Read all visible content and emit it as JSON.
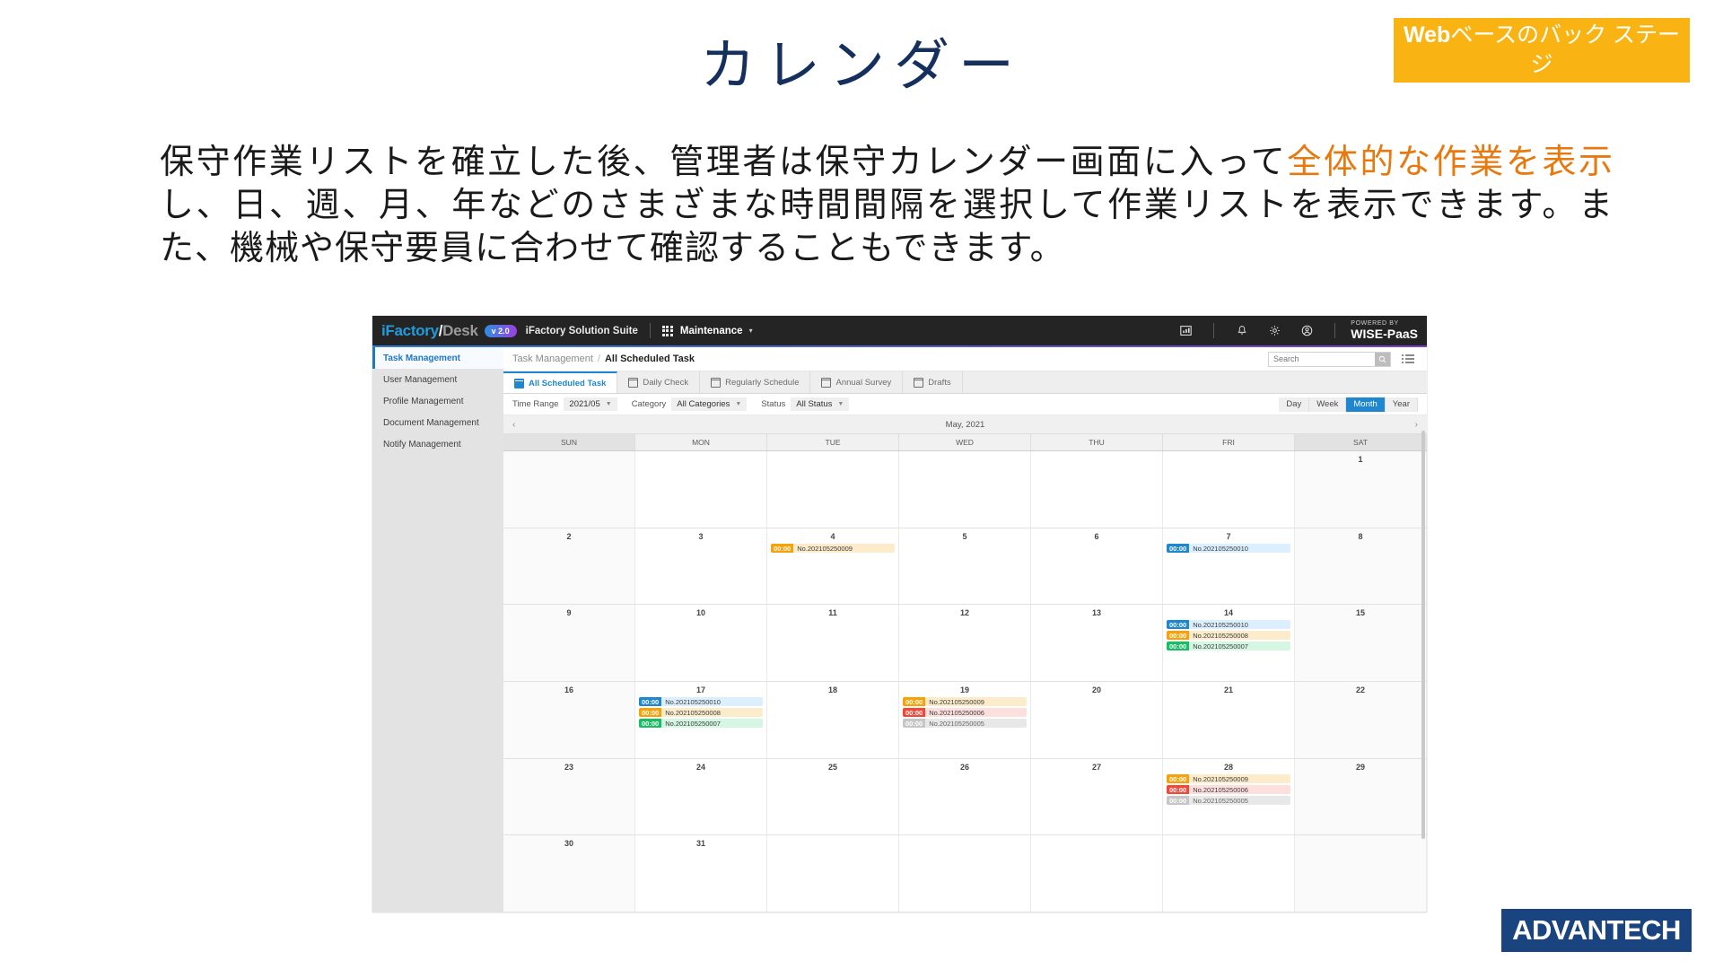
{
  "slide": {
    "title": "カレンダー",
    "badge_bold": "Web",
    "badge_rest": "ベースのバック ステージ",
    "paragraph_1": "保守作業リストを確立した後、管理者は保守カレンダー画面に入って",
    "paragraph_highlight": "全体的な作業を表示",
    "paragraph_2": "し、日、週、月、年などのさまざまな時間間隔を選択して作業リストを表示できます。また、機械や保守要員に合わせて確認することもできます。",
    "footer_logo": "ADVANTECH",
    "accent_color": "#f9b413",
    "title_color": "#16305e",
    "highlight_color": "#e8790f",
    "logo_color": "#1a4480"
  },
  "app": {
    "brand": {
      "i": "iFactory",
      "slash": "/",
      "desk": "Desk",
      "version": "v 2.0",
      "suite": "iFactory Solution Suite"
    },
    "module": "Maintenance",
    "powered_by": "POWERED BY",
    "platform": "WISE-PaaS",
    "header_icons": [
      "report-icon",
      "bell-icon",
      "gear-icon",
      "account-icon"
    ],
    "sidebar": {
      "items": [
        {
          "label": "Task Management",
          "active": true
        },
        {
          "label": "User Management",
          "active": false
        },
        {
          "label": "Profile Management",
          "active": false
        },
        {
          "label": "Document Management",
          "active": false
        },
        {
          "label": "Notify Management",
          "active": false
        }
      ]
    },
    "breadcrumb": {
      "parent": "Task Management",
      "separator": "/",
      "current": "All Scheduled Task"
    },
    "search": {
      "placeholder": "Search",
      "value": ""
    },
    "tabs": [
      {
        "label": "All Scheduled Task",
        "active": true
      },
      {
        "label": "Daily Check",
        "active": false
      },
      {
        "label": "Regularly Schedule",
        "active": false
      },
      {
        "label": "Annual Survey",
        "active": false
      },
      {
        "label": "Drafts",
        "active": false
      }
    ],
    "filters": [
      {
        "label": "Time Range",
        "value": "2021/05"
      },
      {
        "label": "Category",
        "value": "All Categories"
      },
      {
        "label": "Status",
        "value": "All Status"
      }
    ],
    "view_modes": [
      {
        "label": "Day",
        "active": false
      },
      {
        "label": "Week",
        "active": false
      },
      {
        "label": "Month",
        "active": true
      },
      {
        "label": "Year",
        "active": false
      }
    ],
    "calendar": {
      "month_label": "May, 2021",
      "prev_arrow": "‹",
      "next_arrow": "›",
      "day_headers": [
        "SUN",
        "MON",
        "TUE",
        "WED",
        "THU",
        "FRI",
        "SAT"
      ],
      "weeks": [
        [
          {
            "day": ""
          },
          {
            "day": ""
          },
          {
            "day": ""
          },
          {
            "day": ""
          },
          {
            "day": ""
          },
          {
            "day": ""
          },
          {
            "day": "1",
            "events": []
          }
        ],
        [
          {
            "day": "2",
            "events": []
          },
          {
            "day": "3",
            "events": []
          },
          {
            "day": "4",
            "events": [
              {
                "time": "00:00",
                "no": "No.202105250009",
                "color": "orange"
              }
            ]
          },
          {
            "day": "5",
            "events": []
          },
          {
            "day": "6",
            "events": []
          },
          {
            "day": "7",
            "events": [
              {
                "time": "00:00",
                "no": "No.202105250010",
                "color": "blue"
              }
            ]
          },
          {
            "day": "8",
            "events": []
          }
        ],
        [
          {
            "day": "9",
            "events": []
          },
          {
            "day": "10",
            "events": []
          },
          {
            "day": "11",
            "events": []
          },
          {
            "day": "12",
            "events": []
          },
          {
            "day": "13",
            "events": []
          },
          {
            "day": "14",
            "events": [
              {
                "time": "00:00",
                "no": "No.202105250010",
                "color": "blue"
              },
              {
                "time": "00:00",
                "no": "No.202105250008",
                "color": "orange"
              },
              {
                "time": "00:00",
                "no": "No.202105250007",
                "color": "green"
              }
            ]
          },
          {
            "day": "15",
            "events": []
          }
        ],
        [
          {
            "day": "16",
            "events": []
          },
          {
            "day": "17",
            "events": [
              {
                "time": "00:00",
                "no": "No.202105250010",
                "color": "blue"
              },
              {
                "time": "00:00",
                "no": "No.202105250008",
                "color": "orange"
              },
              {
                "time": "00:00",
                "no": "No.202105250007",
                "color": "green"
              }
            ]
          },
          {
            "day": "18",
            "events": []
          },
          {
            "day": "19",
            "events": [
              {
                "time": "00:00",
                "no": "No.202105250009",
                "color": "orange"
              },
              {
                "time": "00:00",
                "no": "No.202105250006",
                "color": "red"
              },
              {
                "time": "00:00",
                "no": "No.202105250005",
                "color": "gray"
              }
            ]
          },
          {
            "day": "20",
            "events": []
          },
          {
            "day": "21",
            "events": []
          },
          {
            "day": "22",
            "events": []
          }
        ],
        [
          {
            "day": "23",
            "events": []
          },
          {
            "day": "24",
            "events": []
          },
          {
            "day": "25",
            "events": []
          },
          {
            "day": "26",
            "events": []
          },
          {
            "day": "27",
            "events": []
          },
          {
            "day": "28",
            "events": [
              {
                "time": "00:00",
                "no": "No.202105250009",
                "color": "orange"
              },
              {
                "time": "00:00",
                "no": "No.202105250006",
                "color": "red"
              },
              {
                "time": "00:00",
                "no": "No.202105250005",
                "color": "gray"
              }
            ]
          },
          {
            "day": "29",
            "events": []
          }
        ],
        [
          {
            "day": "30",
            "events": []
          },
          {
            "day": "31",
            "events": []
          },
          {
            "day": ""
          },
          {
            "day": ""
          },
          {
            "day": ""
          },
          {
            "day": ""
          },
          {
            "day": ""
          }
        ]
      ]
    }
  }
}
